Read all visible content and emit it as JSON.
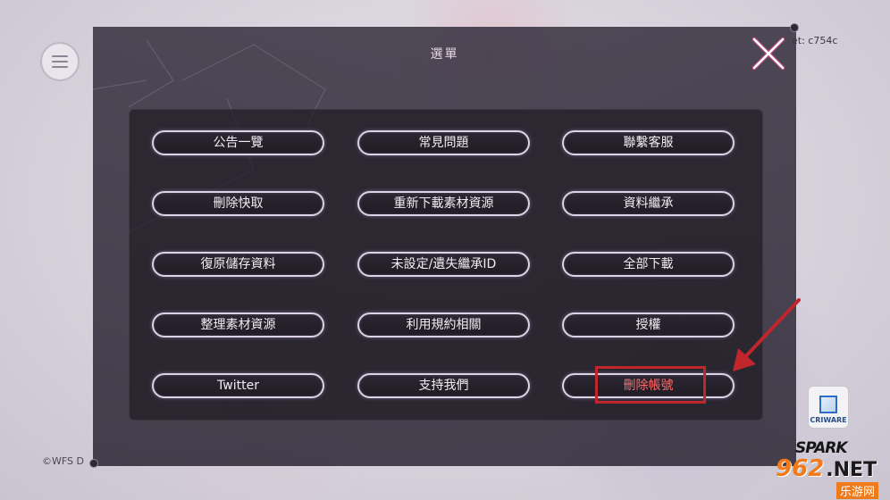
{
  "header": {
    "title": "選單",
    "id_text": "et: c754c"
  },
  "menu_buttons": [
    {
      "label": "公告一覽"
    },
    {
      "label": "常見問題"
    },
    {
      "label": "聯繫客服"
    },
    {
      "label": "刪除快取"
    },
    {
      "label": "重新下載素材資源"
    },
    {
      "label": "資料繼承"
    },
    {
      "label": "復原儲存資料"
    },
    {
      "label": "未設定/遺失繼承ID"
    },
    {
      "label": "全部下載"
    },
    {
      "label": "整理素材資源"
    },
    {
      "label": "利用規約相關"
    },
    {
      "label": "授權"
    },
    {
      "label": "Twitter"
    },
    {
      "label": "支持我們"
    },
    {
      "label": "刪除帳號"
    }
  ],
  "footer": {
    "copyright": "©WFS D",
    "criware_label": "CRIWARE",
    "spark_logo": "SPARK"
  },
  "watermark": {
    "brand_number": "962",
    "brand_suffix": ".NET",
    "sub_text": "乐游网"
  },
  "icons": {
    "menu": "hamburger-icon",
    "close": "close-icon",
    "annotation_arrow": "arrow-icon"
  },
  "colors": {
    "accent_pink": "#ff4fa0",
    "danger_red": "#ff6b6b",
    "annotation_red": "#c0262c",
    "button_border": "#dcd3e6",
    "panel_bg": "#3a3442"
  }
}
